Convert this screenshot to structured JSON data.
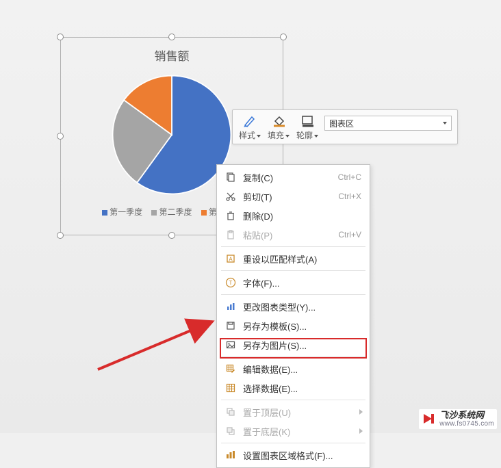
{
  "chart_data": {
    "type": "pie",
    "title": "销售额",
    "series": [
      {
        "name": "第一季度",
        "value": 60,
        "color": "#4472c4"
      },
      {
        "name": "第二季度",
        "value": 25,
        "color": "#a5a5a5"
      },
      {
        "name": "第三季度",
        "value": 15,
        "color": "#ed7d31"
      }
    ],
    "legend_position": "bottom"
  },
  "toolbar": {
    "style_label": "样式",
    "fill_label": "填充",
    "outline_label": "轮廓",
    "selector_value": "图表区"
  },
  "ctx": {
    "copy": "复制(C)",
    "cut": "剪切(T)",
    "delete": "删除(D)",
    "paste": "粘贴(P)",
    "reset_style": "重设以匹配样式(A)",
    "font": "字体(F)...",
    "change_type": "更改图表类型(Y)...",
    "save_template": "另存为模板(S)...",
    "save_image": "另存为图片(S)...",
    "edit_data": "编辑数据(E)...",
    "select_data": "选择数据(E)...",
    "bring_front": "置于顶层(U)",
    "send_back": "置于底层(K)",
    "format_area": "设置图表区域格式(F)...",
    "sc_copy": "Ctrl+C",
    "sc_cut": "Ctrl+X",
    "sc_paste": "Ctrl+V"
  },
  "watermark": {
    "title": "飞沙系统网",
    "url": "www.fs0745.com"
  }
}
